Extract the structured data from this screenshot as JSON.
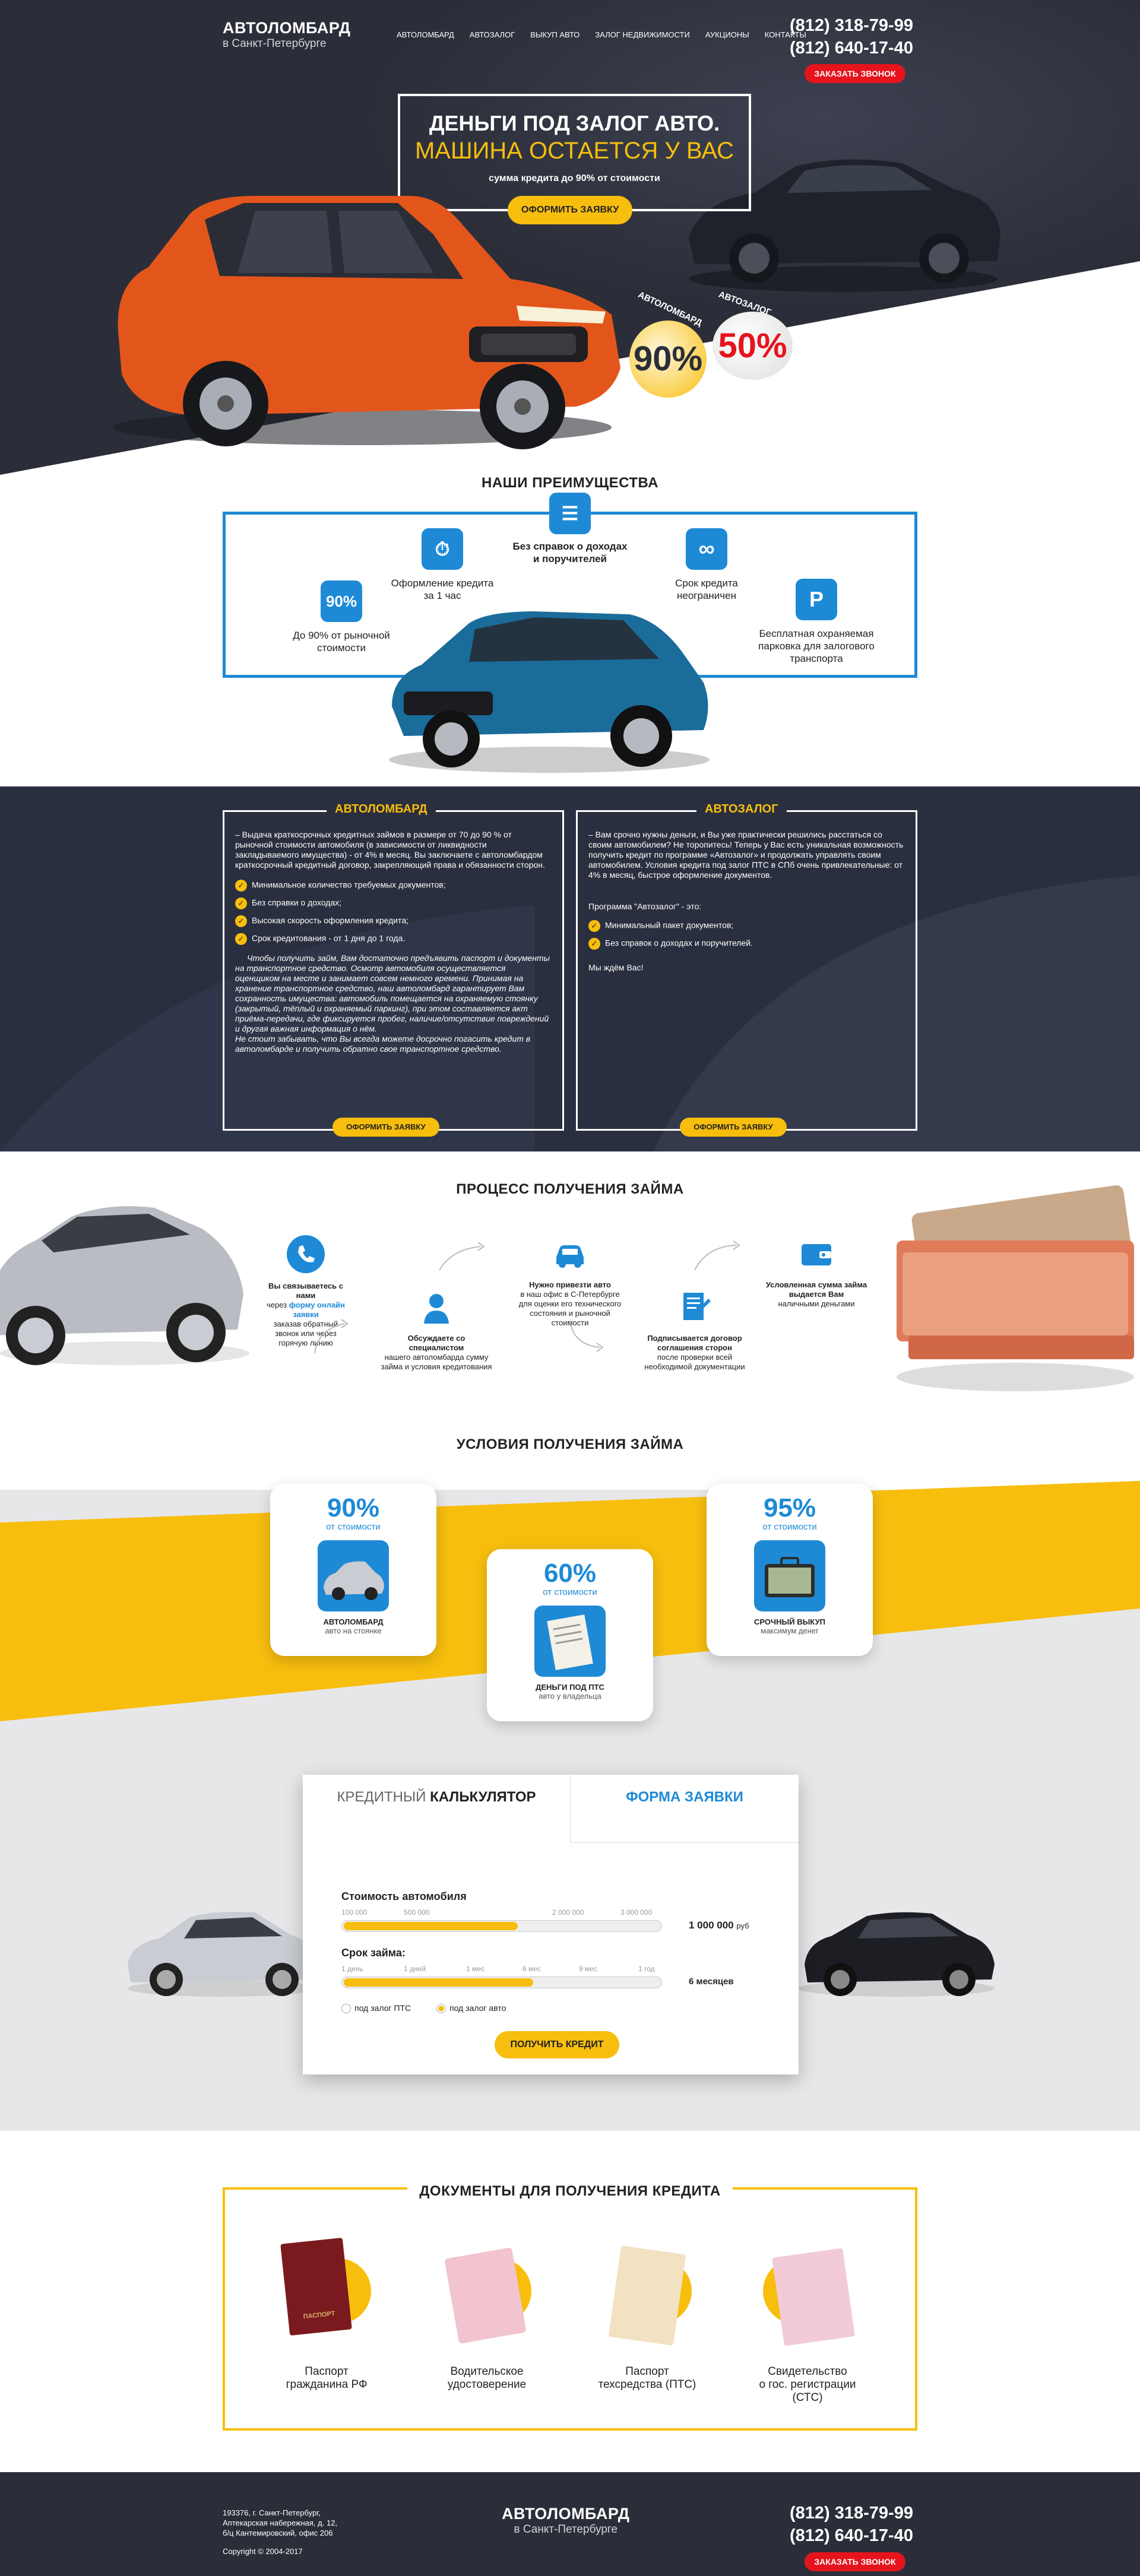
{
  "header": {
    "brand": "АВТОЛОМБАРД",
    "brand_sub": "в Санкт-Петербурге",
    "nav": [
      "Автоломбард",
      "Автозалог",
      "Выкуп авто",
      "Залог недвижимости",
      "Аукционы",
      "Контакты"
    ],
    "phone1": "(812) 318-79-99",
    "phone2": "(812) 640-17-40",
    "callback": "ЗАКАЗАТЬ ЗВОНОК"
  },
  "hero": {
    "title1": "ДЕНЬГИ ПОД ЗАЛОГ АВТО.",
    "title2": "МАШИНА ОСТАЕТСЯ У ВАС",
    "subtitle": "сумма кредита до 90% от стоимости",
    "cta": "ОФОРМИТЬ ЗАЯВКУ",
    "badge1_label": "АВТОЛОМБАРД",
    "badge1_value": "90%",
    "badge2_label": "АВТОЗАЛОГ",
    "badge2_value": "50%"
  },
  "advantages": {
    "title": "НАШИ ПРЕИМУЩЕСТВА",
    "items": [
      {
        "icon": "percent-icon",
        "icon_text": "90%",
        "text": "До 90% от рыночной стоимости"
      },
      {
        "icon": "timer-icon",
        "text": "Оформление кредита за 1 час"
      },
      {
        "icon": "document-icon",
        "text": "Без справок о доходах и поручителей"
      },
      {
        "icon": "infinity-icon",
        "text": "Срок кредита неограничен"
      },
      {
        "icon": "parking-icon",
        "icon_text": "P",
        "text": "Бесплатная охраняемая парковка для залогового транспорта"
      }
    ]
  },
  "blocks": {
    "left": {
      "title": "АВТОЛОМБАРД",
      "intro": "– Выдача краткосрочных кредитных займов в размере от 70 до 90 % от рыночной стоимости автомобиля (в зависимости от ликвидности закладываемого имущества) - от 4% в месяц. Вы заключаете с автоломбардом краткосрочный кредитный договор, закрепляющий права и обязанности сторон.",
      "list": [
        "Минимальное количество требуемых документов;",
        "Без справки о доходах;",
        "Высокая скорость оформления кредита;",
        "Срок кредитования - от 1 дня до 1 года."
      ],
      "body": "Чтобы получить займ, Вам достаточно предъявить паспорт и документы на транспортное средство. Осмотр автомобиля осуществляется оценщиком на месте и занимает совсем немного времени. Принимая на хранение транспортное средство, наш автоломбард гарантирует Вам сохранность имущества: автомобиль помещается на охраняемую стоянку (закрытый, тёплый и охраняемый паркинг), при этом составляется акт приёма-передачи, где фиксируется пробег, наличие/отсутствие повреждений и другая важная информация о нём.",
      "outro": "Не стоит забывать, что Вы всегда можете досрочно погасить кредит в автоломбарде и получить обратно свое транспортное средство.",
      "cta": "ОФОРМИТЬ ЗАЯВКУ"
    },
    "right": {
      "title": "АВТОЗАЛОГ",
      "intro": "– Вам срочно нужны деньги, и Вы уже практически решились расстаться со своим автомобилем? Не торопитесь! Теперь у Вас есть уникальная возможность получить кредит по программе «Автозалог» и продолжать управлять своим автомобилем. Условия кредита под залог ПТС в СПб очень привлекательные: от 4% в месяц, быстрое оформление документов.",
      "program": "Программа \"Автозалог\" - это:",
      "list": [
        "Минимальный пакет документов;",
        "Без справок о доходах и поручителей."
      ],
      "outro": "Мы ждём Вас!",
      "cta": "ОФОРМИТЬ ЗАЯВКУ"
    }
  },
  "process": {
    "title": "ПРОЦЕСС ПОЛУЧЕНИЯ ЗАЙМА",
    "steps": [
      {
        "icon": "phone-icon",
        "bold": "Вы связываетесь с нами",
        "pre": "через ",
        "link": "форму онлайн заявки",
        "text": "заказав обратный звонок или через горячую линию"
      },
      {
        "icon": "operator-icon",
        "bold": "Обсуждаете со специалистом",
        "text": "нашего автоломбарда сумму займа и условия кредитования"
      },
      {
        "icon": "car-icon",
        "bold": "Нужно привезти авто",
        "text": "в наш офис в С-Петербурге для оценки его технического состояния и рыночной стоимости"
      },
      {
        "icon": "contract-icon",
        "bold": "Подписывается договор соглашения сторон",
        "text": "после проверки всей необходимой документации"
      },
      {
        "icon": "wallet-icon",
        "bold": "Условленная сумма займа выдается Вам",
        "text": "наличными деньгами"
      }
    ]
  },
  "conditions": {
    "title": "УСЛОВИЯ ПОЛУЧЕНИЯ ЗАЙМА",
    "cards": [
      {
        "value": "90%",
        "sub": "от стоимости",
        "title": "АВТОЛОМБАРД",
        "desc": "авто на стоянке",
        "icon": "car-photo-icon"
      },
      {
        "value": "60%",
        "sub": "от стоимости",
        "title": "ДЕНЬГИ ПОД ПТС",
        "desc": "авто у владельца",
        "icon": "document-photo-icon"
      },
      {
        "value": "95%",
        "sub": "от стоимости",
        "title": "СРОЧНЫЙ ВЫКУП",
        "desc": "максимум денег",
        "icon": "money-case-icon"
      }
    ]
  },
  "calculator": {
    "tab1_light": "КРЕДИТНЫЙ ",
    "tab1_bold": "КАЛЬКУЛЯТОР",
    "tab2": "ФОРМА ЗАЯВКИ",
    "price_label": "Стоимость автомобиля",
    "price_ticks": [
      "100 000",
      "500 000",
      "2 000 000",
      "3 000 000"
    ],
    "price_value": "1 000 000",
    "price_unit": "руб",
    "price_fill": 0.55,
    "term_label": "Срок займа:",
    "term_ticks": [
      "1 день",
      "1 дней",
      "1 мес",
      "6 мес",
      "9 мес",
      "1 год"
    ],
    "term_value": "6 месяцев",
    "term_fill": 0.6,
    "radio1": "под залог ПТС",
    "radio2": "под залог авто",
    "cta": "ПОЛУЧИТЬ КРЕДИТ"
  },
  "documents": {
    "title": "ДОКУМЕНТЫ ДЛЯ ПОЛУЧЕНИЯ КРЕДИТА",
    "items": [
      {
        "icon": "passport-icon",
        "line1": "Паспорт",
        "line2": "гражданина РФ",
        "line3": ""
      },
      {
        "icon": "license-icon",
        "line1": "Водительское",
        "line2": "удостоверение",
        "line3": ""
      },
      {
        "icon": "pts-icon",
        "line1": "Паспорт",
        "line2": "техсредства (ПТС)",
        "line3": ""
      },
      {
        "icon": "sts-icon",
        "line1": "Свидетельство",
        "line2": "о гос. регистрации",
        "line3": "(СТС)"
      }
    ],
    "passport_word": "ПАСПОРТ"
  },
  "footer": {
    "address1": "193376, г. Санкт-Петербург,",
    "address2": "Аптекарская набережная, д. 12,",
    "address3": "б/ц Кантемировский, офис 206",
    "copyright": "Copyright © 2004-2017",
    "brand": "АВТОЛОМБАРД",
    "brand_sub": "в Санкт-Петербурге",
    "phone1": "(812) 318-79-99",
    "phone2": "(812) 640-17-40",
    "callback": "ЗАКАЗАТЬ ЗВОНОК"
  },
  "colors": {
    "accent": "#f7be0e",
    "blue": "#1e8ad6",
    "red": "#e5141d",
    "dark": "#2b2e38"
  }
}
